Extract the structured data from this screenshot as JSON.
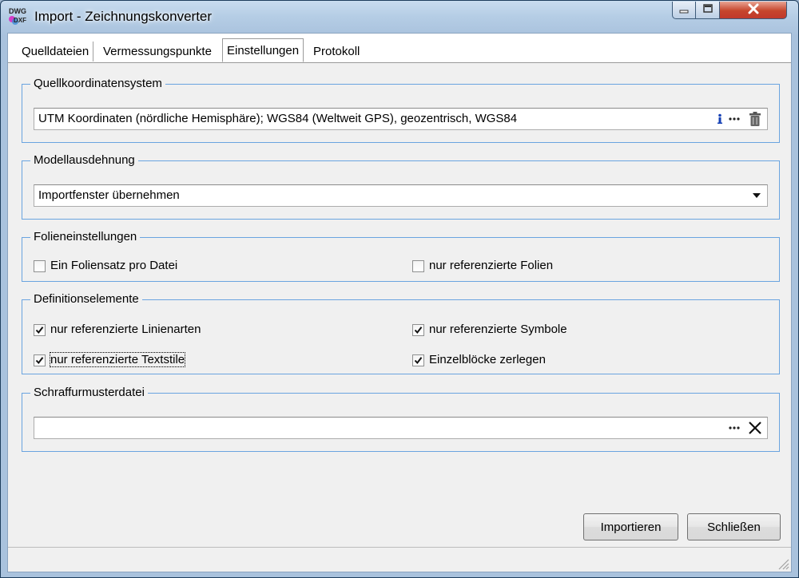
{
  "window": {
    "title": "Import - Zeichnungskonverter",
    "icon": "dwg-dxf-icon",
    "controls": [
      "minimize-icon",
      "maximize-icon",
      "close-icon"
    ]
  },
  "tabs": [
    {
      "label": "Quelldateien"
    },
    {
      "label": "Vermessungspunkte"
    },
    {
      "label": "Einstellungen",
      "active": true
    },
    {
      "label": "Protokoll"
    }
  ],
  "source_crs": {
    "legend": "Quellkoordinatensystem",
    "value": "UTM Koordinaten (nördliche Hemisphäre); WGS84 (Weltweit GPS), geozentrisch, WGS84",
    "icons": [
      "info-icon",
      "ellipsis-icon",
      "trash-icon"
    ]
  },
  "model_extent": {
    "legend": "Modellausdehnung",
    "selected": "Importfenster übernehmen"
  },
  "layer_settings": {
    "legend": "Folieneinstellungen",
    "one_layerset_label": "Ein Foliensatz pro Datei",
    "one_layerset_checked": false,
    "referenced_layers_label": "nur referenzierte Folien",
    "referenced_layers_checked": false
  },
  "definition_elements": {
    "legend": "Definitionselemente",
    "linetypes_label": "nur referenzierte Linienarten",
    "linetypes_checked": true,
    "symbols_label": "nur referenzierte Symbole",
    "symbols_checked": true,
    "textstyles_label": "nur referenzierte Textstile",
    "textstyles_checked": true,
    "explode_blocks_label": "Einzelblöcke zerlegen",
    "explode_blocks_checked": true
  },
  "hatch_file": {
    "legend": "Schraffurmusterdatei",
    "value": "",
    "icons": [
      "ellipsis-icon",
      "clear-x-icon"
    ]
  },
  "buttons": {
    "import_label": "Importieren",
    "close_label": "Schließen"
  },
  "colors": {
    "group_border": "#6aa4e0",
    "close_button": "#c6452c",
    "window_frame": "#a9c2dd"
  }
}
